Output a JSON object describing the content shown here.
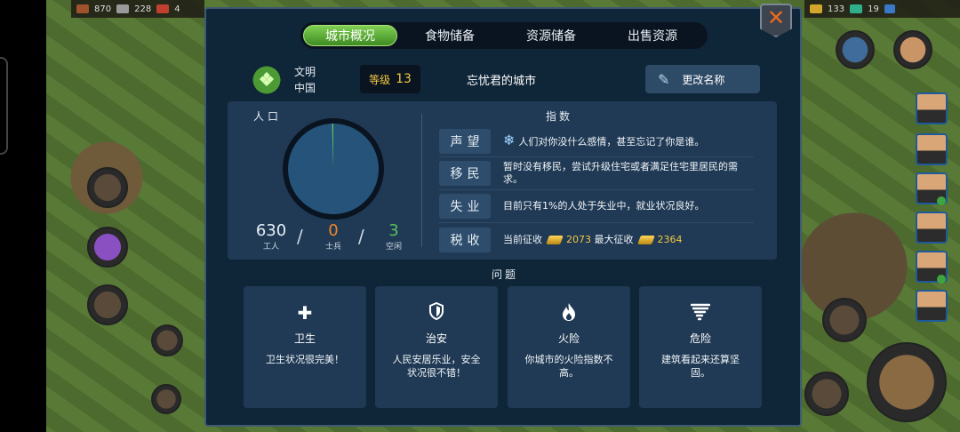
{
  "topbar": {
    "left": [
      "870",
      "228",
      "4"
    ],
    "right": [
      "133",
      "19"
    ]
  },
  "tabs": [
    {
      "label": "城市概况",
      "active": true
    },
    {
      "label": "食物储备",
      "active": false
    },
    {
      "label": "资源储备",
      "active": false
    },
    {
      "label": "出售资源",
      "active": false
    }
  ],
  "header": {
    "civ_label": "文明",
    "civ_name": "中国",
    "level_label": "等级",
    "level_value": "13",
    "city_name": "忘忧君的城市",
    "rename_label": "更改名称"
  },
  "population": {
    "title": "人口",
    "workers": {
      "value": "630",
      "label": "工人"
    },
    "soldiers": {
      "value": "0",
      "label": "士兵"
    },
    "idle": {
      "value": "3",
      "label": "空闲"
    },
    "colors": {
      "workers": "#25537a",
      "soldiers": "#f0852a",
      "idle": "#5bbf5b"
    }
  },
  "indices": {
    "title": "指数",
    "rows": [
      {
        "label": "声望",
        "text": "人们对你没什么感情，甚至忘记了你是谁。"
      },
      {
        "label": "移民",
        "text": "暂时没有移民，尝试升级住宅或者满足住宅里居民的需求。"
      },
      {
        "label": "失业",
        "text": "目前只有1%的人处于失业中，就业状况良好。"
      },
      {
        "label": "税收",
        "current_label": "当前征收",
        "current_value": "2073",
        "max_label": "最大征收",
        "max_value": "2364"
      }
    ]
  },
  "issues": {
    "title": "问题",
    "cards": [
      {
        "title": "卫生",
        "desc": "卫生状况很完美！",
        "icon": "plus-icon"
      },
      {
        "title": "治安",
        "desc": "人民安居乐业，安全状况很不错！",
        "icon": "shield-icon"
      },
      {
        "title": "火险",
        "desc": "你城市的火险指数不高。",
        "icon": "fire-icon"
      },
      {
        "title": "危险",
        "desc": "建筑看起来还算坚固。",
        "icon": "tornado-icon"
      }
    ]
  }
}
